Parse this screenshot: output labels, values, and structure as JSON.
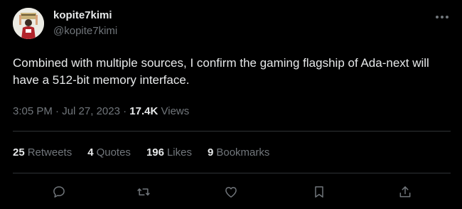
{
  "user": {
    "display_name": "kopite7kimi",
    "handle": "@kopite7kimi"
  },
  "tweet": {
    "text": "Combined with multiple sources, I confirm the gaming flagship of Ada-next will have a 512-bit memory interface.",
    "time": "3:05 PM",
    "date": "Jul 27, 2023",
    "separator": "·",
    "views_count": "17.4K",
    "views_label": "Views"
  },
  "stats": [
    {
      "count": "25",
      "label": "Retweets"
    },
    {
      "count": "4",
      "label": "Quotes"
    },
    {
      "count": "196",
      "label": "Likes"
    },
    {
      "count": "9",
      "label": "Bookmarks"
    }
  ],
  "actions": [
    {
      "icon": "reply-icon"
    },
    {
      "icon": "retweet-icon"
    },
    {
      "icon": "like-icon"
    },
    {
      "icon": "bookmark-icon"
    },
    {
      "icon": "share-icon"
    }
  ],
  "colors": {
    "background": "#000000",
    "text_primary": "#e7e9ea",
    "text_secondary": "#71767b",
    "divider": "#2f3336"
  }
}
